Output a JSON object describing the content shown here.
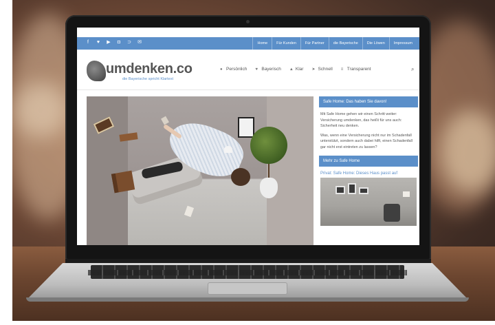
{
  "site": {
    "logo_text": "umdenken.co",
    "tagline": "die Bayerische spricht Klartext"
  },
  "topbar": {
    "social_icons": [
      "facebook-icon",
      "twitter-icon",
      "youtube-icon",
      "instagram-icon",
      "rss-icon",
      "email-icon"
    ],
    "links": [
      "Home",
      "Für Kunden",
      "Für Partner",
      "die Bayerische",
      "Die Löwen",
      "Impressum"
    ]
  },
  "mainnav": {
    "items": [
      {
        "label": "Persönlich",
        "icon": "user-icon"
      },
      {
        "label": "Bayerisch",
        "icon": "heart-icon"
      },
      {
        "label": "Klar",
        "icon": "thumbs-up-icon"
      },
      {
        "label": "Schnell",
        "icon": "rocket-icon"
      },
      {
        "label": "Transparent",
        "icon": "list-icon"
      }
    ]
  },
  "sidebar": {
    "box1_title": "Safe Home: Das haben Sie davon!",
    "box1_paragraphs": [
      "Mit Safe Home gehen wir einen Schritt weiter: Versicherung umdenken, das heißt für uns auch: Sicherheit neu denken.",
      "Was, wenn eine Versicherung nicht nur im Schadenfall unterstützt, sondern auch dabei hilft, einen Schadenfall gar nicht erst eintreten zu lassen?"
    ],
    "box2_title": "Mehr zu Safe Home",
    "box2_link": "Privat: Safe Home: Dieses Haus passt auf"
  },
  "colors": {
    "accent": "#5b8fc9",
    "text": "#555555"
  }
}
